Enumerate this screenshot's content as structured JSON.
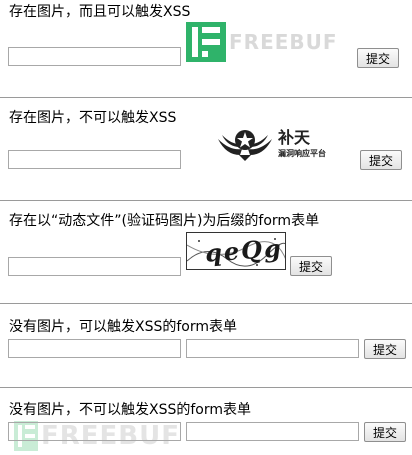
{
  "sections": [
    {
      "heading": "存在图片，而且可以触发XSS",
      "submit_label": "提交",
      "field_value": ""
    },
    {
      "heading": "存在图片，不可以触发XSS",
      "submit_label": "提交",
      "field_value": ""
    },
    {
      "heading": "存在以“动态文件”(验证码图片)为后缀的form表单",
      "submit_label": "提交",
      "field_value": "",
      "captcha_text": "qeQg"
    },
    {
      "heading": "没有图片，可以触发XSS的form表单",
      "submit_label": "提交",
      "field1_value": "",
      "field2_value": ""
    },
    {
      "heading": "没有图片，不可以触发XSS的form表单",
      "submit_label": "提交",
      "field1_value": "",
      "field2_value": ""
    }
  ],
  "logos": {
    "freebuf_text": "FREEBUF",
    "butian_title": "补天",
    "butian_subtitle": "漏洞响应平台"
  },
  "colors": {
    "freebuf_green": "#2fb36a",
    "freebuf_text": "#d9d9d9",
    "divider": "#9a9a9a",
    "field_border": "#a8a8a8"
  }
}
